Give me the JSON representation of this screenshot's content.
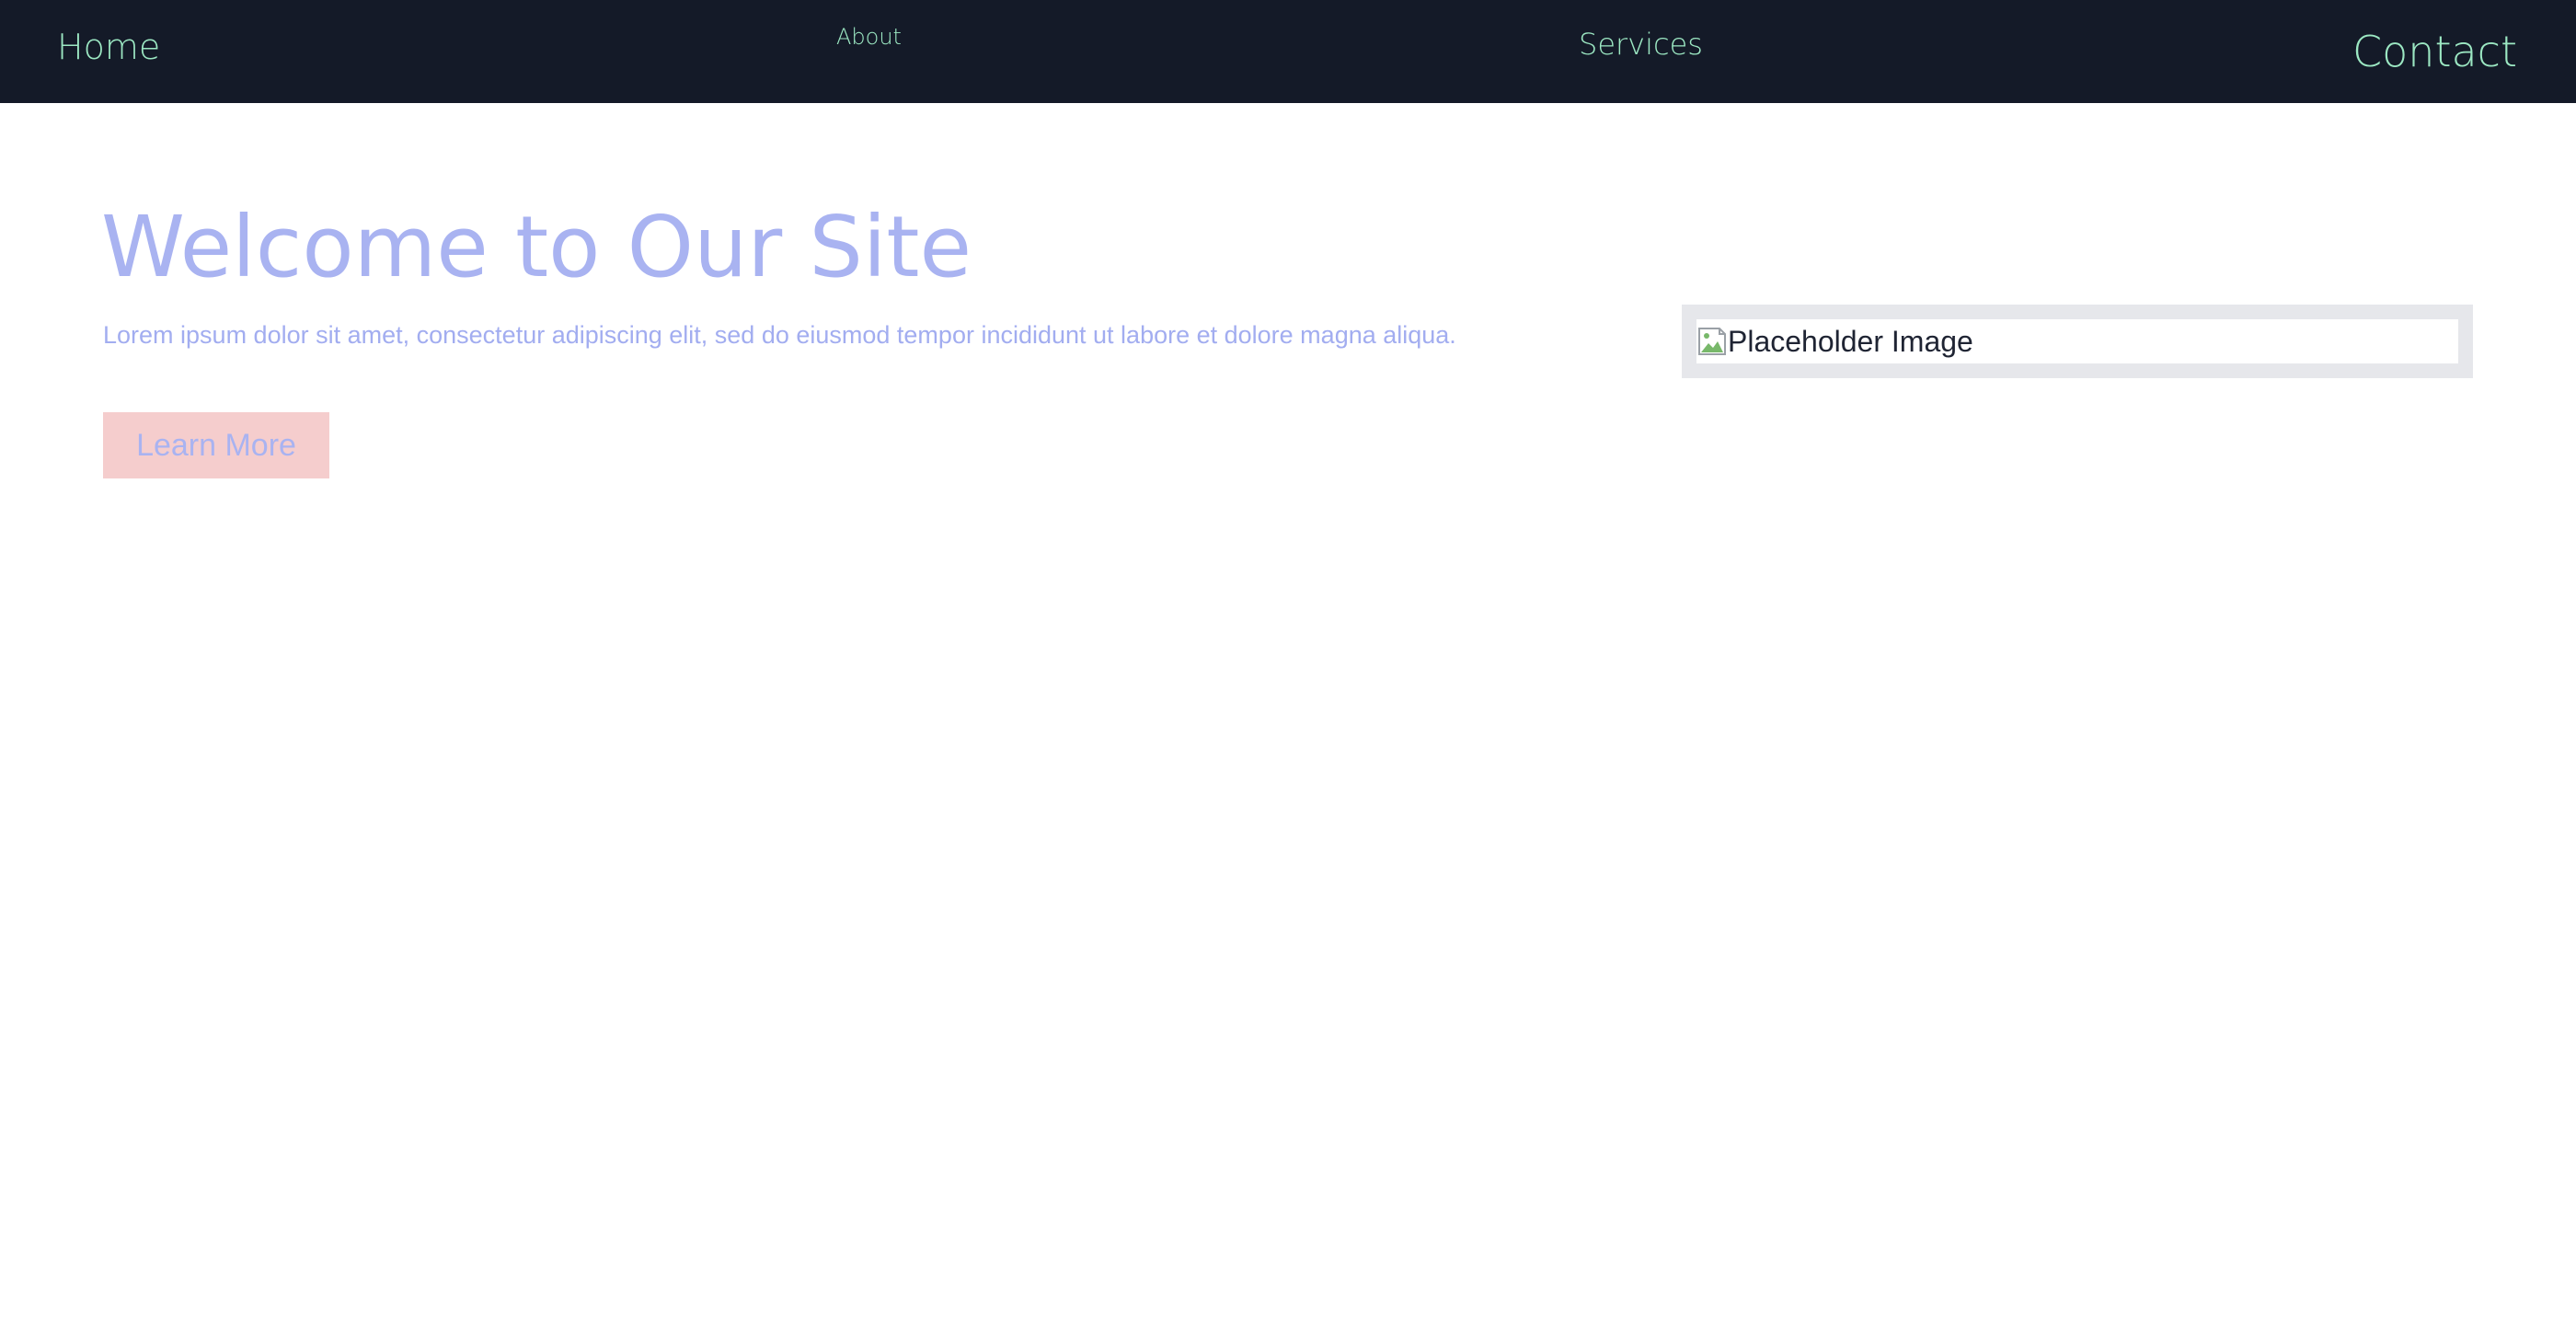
{
  "nav": {
    "home": "Home",
    "about": "About",
    "services": "Services",
    "contact": "Contact"
  },
  "hero": {
    "title": "Welcome to Our Site",
    "text": "Lorem ipsum dolor sit amet, consectetur adipiscing elit, sed do eiusmod tempor incididunt ut labore et dolore magna aliqua.",
    "button_label": "Learn More"
  },
  "image": {
    "alt_text": "Placeholder Image",
    "icon": "broken-image-icon"
  },
  "colors": {
    "nav_background": "#141a28",
    "nav_link": "#9ce8c3",
    "hero_text": "#a9b3f1",
    "button_background": "#f5cdcd",
    "image_frame": "#e6e7eb"
  }
}
